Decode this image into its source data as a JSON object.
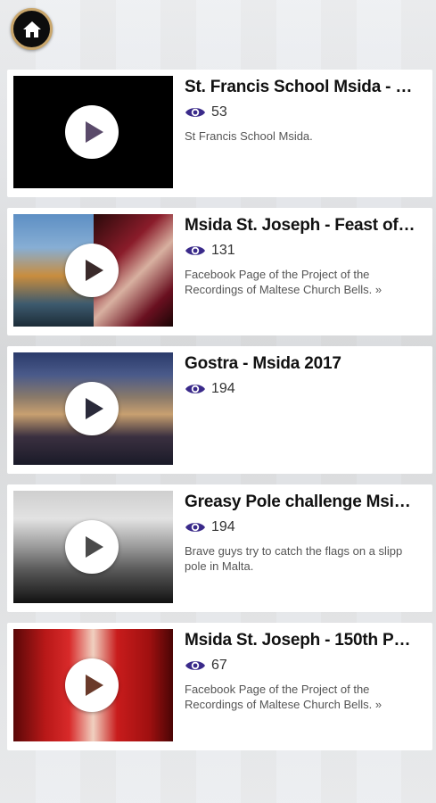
{
  "header": {
    "home_icon": "home-icon"
  },
  "colors": {
    "accent_eye": "#3a2a8a",
    "home_ring": "#c9a66b"
  },
  "videos": [
    {
      "title": "St. Francis School Msida - …",
      "views": "53",
      "description": "St Francis School Msida."
    },
    {
      "title": "Msida St. Joseph - Feast of…",
      "views": "131",
      "description": "Facebook Page of the Project of the Recordings of Maltese Church Bells. »"
    },
    {
      "title": "Gostra - Msida 2017",
      "views": "194",
      "description": ""
    },
    {
      "title": "Greasy Pole challenge Msi…",
      "views": "194",
      "description": "Brave guys try to catch the flags on a slipp pole in Malta."
    },
    {
      "title": "Msida St. Joseph - 150th P…",
      "views": "67",
      "description": "Facebook Page of the Project of the Recordings of Maltese Church Bells. »"
    }
  ]
}
